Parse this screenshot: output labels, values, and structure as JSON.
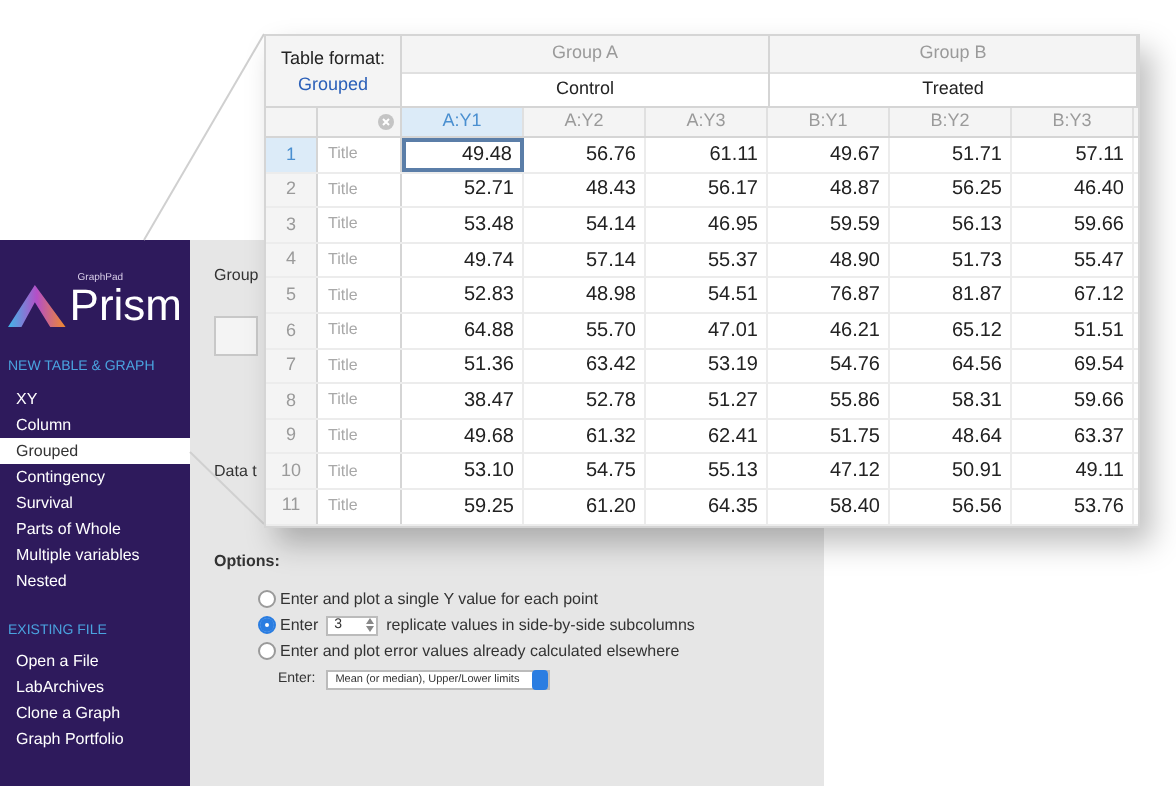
{
  "sidebar": {
    "logo_small": "GraphPad",
    "logo": "Prism",
    "sections": [
      {
        "heading": "NEW TABLE & GRAPH",
        "items": [
          {
            "label": "XY",
            "selected": false
          },
          {
            "label": "Column",
            "selected": false
          },
          {
            "label": "Grouped",
            "selected": true
          },
          {
            "label": "Contingency",
            "selected": false
          },
          {
            "label": "Survival",
            "selected": false
          },
          {
            "label": "Parts of Whole",
            "selected": false
          },
          {
            "label": "Multiple variables",
            "selected": false
          },
          {
            "label": "Nested",
            "selected": false
          }
        ]
      },
      {
        "heading": "EXISTING FILE",
        "items": [
          {
            "label": "Open a File",
            "selected": false
          },
          {
            "label": "LabArchives",
            "selected": false
          },
          {
            "label": "Clone a Graph",
            "selected": false
          },
          {
            "label": "Graph Portfolio",
            "selected": false
          }
        ]
      }
    ]
  },
  "panel": {
    "group_label": "Group",
    "data_label": "Data t",
    "options_label": "Options:",
    "options": [
      {
        "kind": "plain",
        "selected": false,
        "text": "Enter and plot a single Y value for each point"
      },
      {
        "kind": "replicates",
        "selected": true,
        "before": "Enter",
        "value": "3",
        "after": "replicate values in side-by-side subcolumns"
      },
      {
        "kind": "plain",
        "selected": false,
        "text": "Enter and plot error values already calculated elsewhere"
      }
    ],
    "enter_label": "Enter:",
    "enter_select": "Mean (or median), Upper/Lower limits"
  },
  "table": {
    "format_label": "Table format:",
    "format_value": "Grouped",
    "groups": [
      {
        "title": "Group A",
        "subtitle": "Control"
      },
      {
        "title": "Group B",
        "subtitle": "Treated"
      }
    ],
    "columns": [
      {
        "label": "A:Y1",
        "selected": true
      },
      {
        "label": "A:Y2",
        "selected": false
      },
      {
        "label": "A:Y3",
        "selected": false
      },
      {
        "label": "B:Y1",
        "selected": false
      },
      {
        "label": "B:Y2",
        "selected": false
      },
      {
        "label": "B:Y3",
        "selected": false
      }
    ],
    "rows": [
      {
        "number": "1",
        "selected": true,
        "title_placeholder": "Title",
        "values": [
          "49.48",
          "56.76",
          "61.11",
          "49.67",
          "51.71",
          "57.11"
        ]
      },
      {
        "number": "2",
        "selected": false,
        "title_placeholder": "Title",
        "values": [
          "52.71",
          "48.43",
          "56.17",
          "48.87",
          "56.25",
          "46.40"
        ]
      },
      {
        "number": "3",
        "selected": false,
        "title_placeholder": "Title",
        "values": [
          "53.48",
          "54.14",
          "46.95",
          "59.59",
          "56.13",
          "59.66"
        ]
      },
      {
        "number": "4",
        "selected": false,
        "title_placeholder": "Title",
        "values": [
          "49.74",
          "57.14",
          "55.37",
          "48.90",
          "51.73",
          "55.47"
        ]
      },
      {
        "number": "5",
        "selected": false,
        "title_placeholder": "Title",
        "values": [
          "52.83",
          "48.98",
          "54.51",
          "76.87",
          "81.87",
          "67.12"
        ]
      },
      {
        "number": "6",
        "selected": false,
        "title_placeholder": "Title",
        "values": [
          "64.88",
          "55.70",
          "47.01",
          "46.21",
          "65.12",
          "51.51"
        ]
      },
      {
        "number": "7",
        "selected": false,
        "title_placeholder": "Title",
        "values": [
          "51.36",
          "63.42",
          "53.19",
          "54.76",
          "64.56",
          "69.54"
        ]
      },
      {
        "number": "8",
        "selected": false,
        "title_placeholder": "Title",
        "values": [
          "38.47",
          "52.78",
          "51.27",
          "55.86",
          "58.31",
          "59.66"
        ]
      },
      {
        "number": "9",
        "selected": false,
        "title_placeholder": "Title",
        "values": [
          "49.68",
          "61.32",
          "62.41",
          "51.75",
          "48.64",
          "63.37"
        ]
      },
      {
        "number": "10",
        "selected": false,
        "title_placeholder": "Title",
        "values": [
          "53.10",
          "54.75",
          "55.13",
          "47.12",
          "50.91",
          "49.11"
        ]
      },
      {
        "number": "11",
        "selected": false,
        "title_placeholder": "Title",
        "values": [
          "59.25",
          "61.20",
          "64.35",
          "58.40",
          "56.56",
          "53.76"
        ]
      }
    ]
  }
}
